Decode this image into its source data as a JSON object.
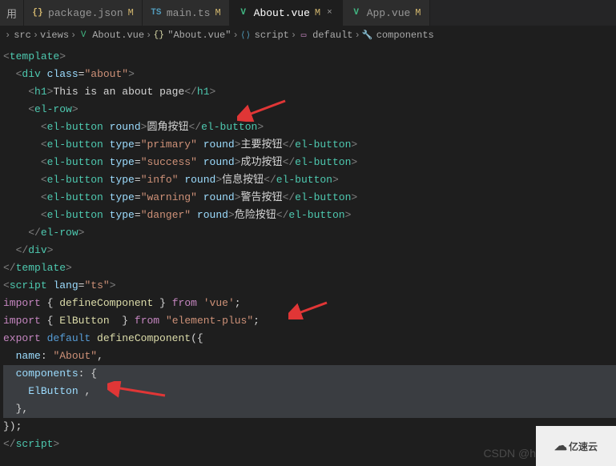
{
  "tabs": {
    "truncated": "用",
    "items": [
      {
        "icon_color": "#d0b56d",
        "icon": "{}",
        "label": "package.json",
        "mod": "M"
      },
      {
        "icon_color": "#519aba",
        "icon": "TS",
        "label": "main.ts",
        "mod": "M"
      },
      {
        "icon_color": "#41b883",
        "icon": "V",
        "label": "About.vue",
        "mod": "M",
        "close": "×",
        "active": true
      },
      {
        "icon_color": "#41b883",
        "icon": "V",
        "label": "App.vue",
        "mod": "M"
      }
    ]
  },
  "breadcrumb": {
    "items": [
      {
        "label": "src"
      },
      {
        "label": "views"
      },
      {
        "icon": "V",
        "icon_color": "#41b883",
        "label": "About.vue"
      },
      {
        "icon": "{}",
        "icon_color": "#dcdcaa",
        "label": "\"About.vue\""
      },
      {
        "icon": "⟨⟩",
        "icon_color": "#519aba",
        "label": "script"
      },
      {
        "icon": "▭",
        "icon_color": "#c586c0",
        "label": "default"
      },
      {
        "icon": "🔧",
        "icon_color": "#9cdcfe",
        "label": "components"
      }
    ]
  },
  "code": {
    "l1": {
      "tag": "template"
    },
    "l2": {
      "tag": "div",
      "attrs": [
        {
          "n": "class",
          "v": "about"
        }
      ]
    },
    "l3": {
      "open": "h1",
      "text": "This is an about page",
      "close": "h1"
    },
    "l4": {
      "tag": "el-row"
    },
    "l5": {
      "tag": "el-button",
      "bool": [
        "round"
      ],
      "text": "圆角按钮",
      "close": "el-button"
    },
    "l6": {
      "tag": "el-button",
      "attrs": [
        {
          "n": "type",
          "v": "primary"
        }
      ],
      "bool": [
        "round"
      ],
      "text": "主要按钮",
      "close": "el-button"
    },
    "l7": {
      "tag": "el-button",
      "attrs": [
        {
          "n": "type",
          "v": "success"
        }
      ],
      "bool": [
        "round"
      ],
      "text": "成功按钮",
      "close": "el-button"
    },
    "l8": {
      "tag": "el-button",
      "attrs": [
        {
          "n": "type",
          "v": "info"
        }
      ],
      "bool": [
        "round"
      ],
      "text": "信息按钮",
      "close": "el-button"
    },
    "l9": {
      "tag": "el-button",
      "attrs": [
        {
          "n": "type",
          "v": "warning"
        }
      ],
      "bool": [
        "round"
      ],
      "text": "警告按钮",
      "close": "el-button"
    },
    "l10": {
      "tag": "el-button",
      "attrs": [
        {
          "n": "type",
          "v": "danger"
        }
      ],
      "bool": [
        "round"
      ],
      "text": "危险按钮",
      "close": "el-button"
    },
    "l11": {
      "close_tag": "el-row"
    },
    "l12": {
      "close_tag": "div"
    },
    "l13": {
      "close_tag": "template"
    },
    "l14": {
      "tag": "script",
      "attrs": [
        {
          "n": "lang",
          "v": "ts"
        }
      ]
    },
    "l15": {
      "import": [
        "defineComponent"
      ],
      "from": "'vue'"
    },
    "l16": {
      "import": [
        "ElButton "
      ],
      "from": "\"element-plus\""
    },
    "l17": "",
    "l18": {
      "export_default": "defineComponent",
      "open": "({"
    },
    "l19": {
      "key": "name",
      "val": "\"About\"",
      "comma": ","
    },
    "l20": {
      "key": "components",
      "open": "{"
    },
    "l21": {
      "ident": "ElButton",
      "comma": " ,"
    },
    "l22": {
      "close": "},"
    },
    "l23": {
      "close": "});"
    },
    "l24": {
      "close_tag": "script"
    }
  },
  "watermark": "CSDN @h",
  "logo": "亿速云"
}
